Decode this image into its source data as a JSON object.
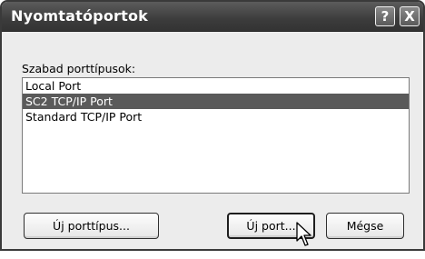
{
  "window": {
    "title": "Nyomtatóportok"
  },
  "titlebar_buttons": {
    "help": "?",
    "close": "X"
  },
  "list": {
    "label": "Szabad porttípusok:",
    "items": [
      "Local Port",
      "SC2 TCP/IP Port",
      "Standard TCP/IP Port"
    ],
    "selected_index": 1
  },
  "buttons": {
    "new_port_type": "Új porttípus...",
    "new_port": "Új port...",
    "cancel": "Mégse"
  }
}
